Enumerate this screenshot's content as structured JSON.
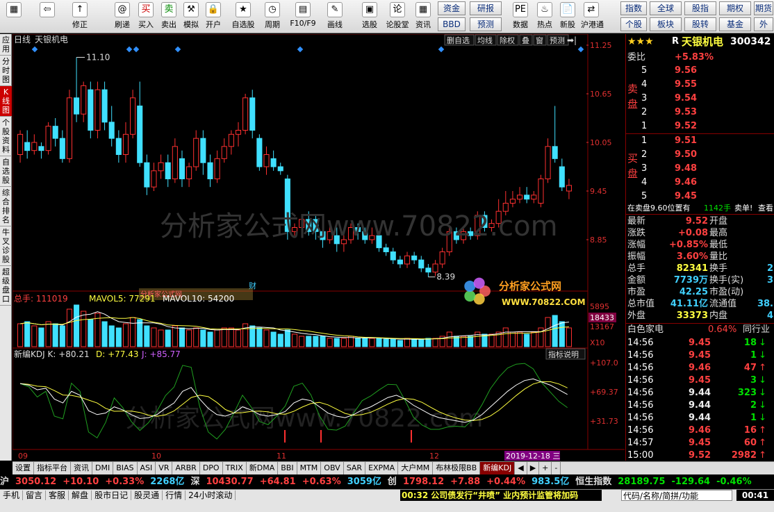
{
  "toolbar": {
    "buttons": [
      "",
      "",
      "修正",
      "刷递",
      "买入",
      "卖出",
      "模拟",
      "开户",
      "自选股",
      "周期",
      "F10/F9",
      "画线",
      "选股",
      "论股堂",
      "资讯",
      "",
      "",
      "数据",
      "热点",
      "新股",
      "沪港通"
    ],
    "tags": [
      "资金",
      "研报",
      "BBD",
      "预测",
      "指数",
      "全球",
      "股指",
      "期权",
      "期货",
      "个股",
      "板块",
      "股转",
      "基金",
      "外"
    ]
  },
  "left_tabs": [
    "应用",
    "分时图",
    "K线图",
    "个股资料",
    "自选股",
    "综合排名",
    "牛叉诊股",
    "超级盘口"
  ],
  "chart": {
    "period": "日线",
    "name": "天银机电",
    "buttons": [
      "删自选",
      "均线",
      "除权",
      "叠",
      "窗",
      "预测"
    ],
    "y_labels": [
      "11.25",
      "10.65",
      "10.05",
      "9.45",
      "8.85"
    ],
    "high_label": "11.10",
    "low_label": "8.39",
    "cai": "财",
    "vol_line": [
      "总手: 111019",
      "MAVOL5: 77291",
      "MAVOL10: 54200"
    ],
    "vol_y": [
      "5895",
      "13167",
      "X10"
    ],
    "vol_box": "18433",
    "kdj_line": [
      "新编KDJ K: +80.21",
      "D: +77.43",
      "J: +85.77"
    ],
    "kdj_btn": "指标说明",
    "kdj_y": [
      "+107.0",
      "+69.37",
      "+31.73"
    ],
    "x_labels": [
      "09",
      "10",
      "11",
      "12"
    ],
    "date_box": "2019-12-18 三",
    "watermark": "分析家公式网www.70822.com",
    "logo_cn": "分析家公式网",
    "logo_url": "WWW.70822.COM",
    "small_wm": "分析家公式网"
  },
  "quote": {
    "header_r": "R",
    "name": "天银机电",
    "code": "300342",
    "webi": "委比",
    "webi_val": "+5.83%",
    "sell_label": "卖盘",
    "buy_label": "买盘",
    "asks": [
      [
        "5",
        "9.56"
      ],
      [
        "4",
        "9.55"
      ],
      [
        "3",
        "9.54"
      ],
      [
        "2",
        "9.53"
      ],
      [
        "1",
        "9.52"
      ]
    ],
    "bids": [
      [
        "1",
        "9.51"
      ],
      [
        "2",
        "9.50"
      ],
      [
        "3",
        "9.48"
      ],
      [
        "4",
        "9.46"
      ],
      [
        "5",
        "9.45"
      ]
    ],
    "note_a": "在卖盘9.60位置有",
    "note_b": "1142手",
    "note_c": "卖单!",
    "note_d": "查看",
    "stats": [
      [
        "最新",
        "9.52",
        "开盘"
      ],
      [
        "涨跌",
        "+0.08",
        "最高"
      ],
      [
        "涨幅",
        "+0.85%",
        "最低"
      ],
      [
        "振幅",
        "3.60%",
        "量比"
      ],
      [
        "总手",
        "82341",
        "换手"
      ],
      [
        "金额",
        "7739万",
        "换手(实)"
      ],
      [
        "市盈",
        "42.25",
        "市盈(动)"
      ],
      [
        "总市值",
        "41.11亿",
        "流通值"
      ],
      [
        "外盘",
        "33373",
        "内盘"
      ]
    ],
    "stat_right": [
      "",
      "",
      "",
      "",
      "2",
      "3",
      "",
      "38.",
      "4"
    ],
    "sector": "白色家电",
    "sector_pct": "0.64%",
    "sector_btn": "同行业",
    "ticks": [
      [
        "14:56",
        "9.45",
        "18"
      ],
      [
        "14:56",
        "9.45",
        "1"
      ],
      [
        "14:56",
        "9.46",
        "47"
      ],
      [
        "14:56",
        "9.45",
        "3"
      ],
      [
        "14:56",
        "9.44",
        "323"
      ],
      [
        "14:56",
        "9.44",
        "2"
      ],
      [
        "14:56",
        "9.44",
        "1"
      ],
      [
        "14:56",
        "9.46",
        "16"
      ],
      [
        "14:57",
        "9.45",
        "60"
      ],
      [
        "15:00",
        "9.52",
        "2982"
      ]
    ],
    "tabs": [
      "细",
      "分",
      "筹",
      "焰",
      "指",
      "关"
    ]
  },
  "bottom_tabs": [
    "设置",
    "指标平台",
    "资讯",
    "DMI",
    "BIAS",
    "ASI",
    "VR",
    "ARBR",
    "DPO",
    "TRIX",
    "新DMA",
    "BBI",
    "MTM",
    "OBV",
    "SAR",
    "EXPMA",
    "大户MM",
    "布林极限BB",
    "新编KDJ"
  ],
  "index_bar": {
    "sh": "沪",
    "sh_v": "3050.12",
    "sh_c": "+10.10",
    "sh_p": "+0.33%",
    "sh_a": "2268亿",
    "sz": "深",
    "sz_v": "10430.77",
    "sz_c": "+64.81",
    "sz_p": "+0.63%",
    "sz_a": "3059亿",
    "cy": "创",
    "cy_v": "1798.12",
    "cy_c": "+7.88",
    "cy_p": "+0.44%",
    "cy_a": "983.5亿",
    "hs": "恒生指数",
    "hs_v": "28189.75",
    "hs_c": "-129.64",
    "hs_p": "-0.46%"
  },
  "status": {
    "items": [
      "手机",
      "留言",
      "客服",
      "解盘",
      "股市日记",
      "股灵通",
      "行情",
      "24小时滚动"
    ],
    "news_time": "00:32",
    "news": "公司债发行“井喷” 业内预计监管将加码",
    "search": "代码/名称/简拼/功能",
    "clock": "00:41"
  }
}
